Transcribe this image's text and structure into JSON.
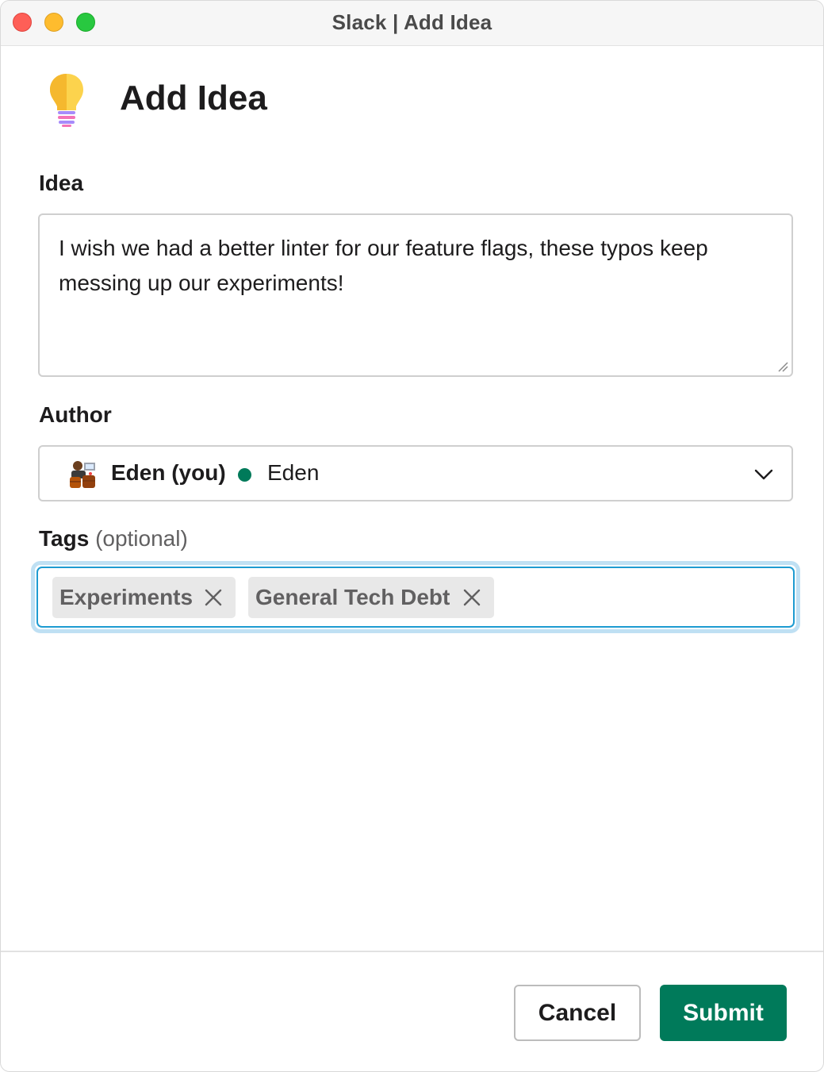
{
  "window": {
    "title": "Slack | Add Idea"
  },
  "header": {
    "icon": "lightbulb-icon",
    "title": "Add Idea"
  },
  "form": {
    "idea": {
      "label": "Idea",
      "value": "I wish we had a better linter for our feature flags, these typos keep messing up our experiments!"
    },
    "author": {
      "label": "Author",
      "avatar": "user-avatar",
      "name": "Eden (you)",
      "presence_color": "#007a5a",
      "display_name": "Eden"
    },
    "tags": {
      "label": "Tags",
      "optional_label": "(optional)",
      "selected": [
        {
          "label": "Experiments"
        },
        {
          "label": "General Tech Debt"
        }
      ]
    }
  },
  "footer": {
    "cancel_label": "Cancel",
    "submit_label": "Submit"
  },
  "colors": {
    "accent": "#007a5a",
    "focus": "#1d9bd1"
  }
}
